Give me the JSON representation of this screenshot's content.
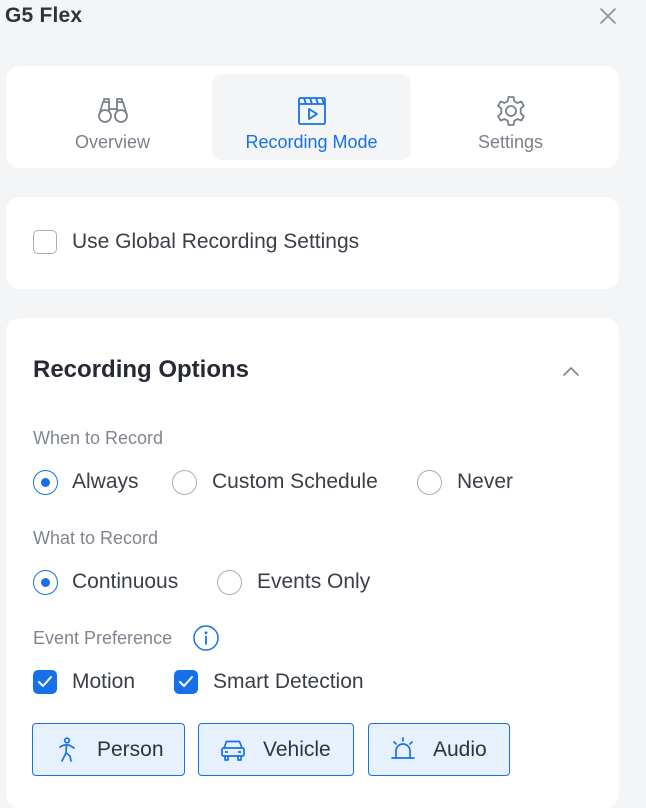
{
  "app": {
    "title": "G5 Flex"
  },
  "tabs": [
    {
      "label": "Overview",
      "icon": "binoculars-icon"
    },
    {
      "label": "Recording Mode",
      "icon": "recording-clapper-icon"
    },
    {
      "label": "Settings",
      "icon": "gear-icon"
    }
  ],
  "active_tab": "Recording Mode",
  "global_settings": {
    "label": "Use Global Recording Settings",
    "checked": false
  },
  "recording_options": {
    "title": "Recording Options",
    "when": {
      "label": "When to Record",
      "options": [
        "Always",
        "Custom Schedule",
        "Never"
      ],
      "selected": "Always"
    },
    "what": {
      "label": "What to Record",
      "options": [
        "Continuous",
        "Events Only"
      ],
      "selected": "Continuous"
    },
    "event_preference": {
      "label": "Event Preference",
      "checkboxes": [
        {
          "label": "Motion",
          "checked": true
        },
        {
          "label": "Smart Detection",
          "checked": true
        }
      ],
      "detection_types": [
        {
          "label": "Person",
          "icon": "person-icon",
          "selected": true
        },
        {
          "label": "Vehicle",
          "icon": "vehicle-icon",
          "selected": true
        },
        {
          "label": "Audio",
          "icon": "alarm-icon",
          "selected": true
        }
      ]
    }
  },
  "colors": {
    "accent": "#1671e8",
    "chip_bg": "#e7f0fd",
    "page_bg": "#f4f5f6",
    "card_bg": "#ffffff"
  }
}
